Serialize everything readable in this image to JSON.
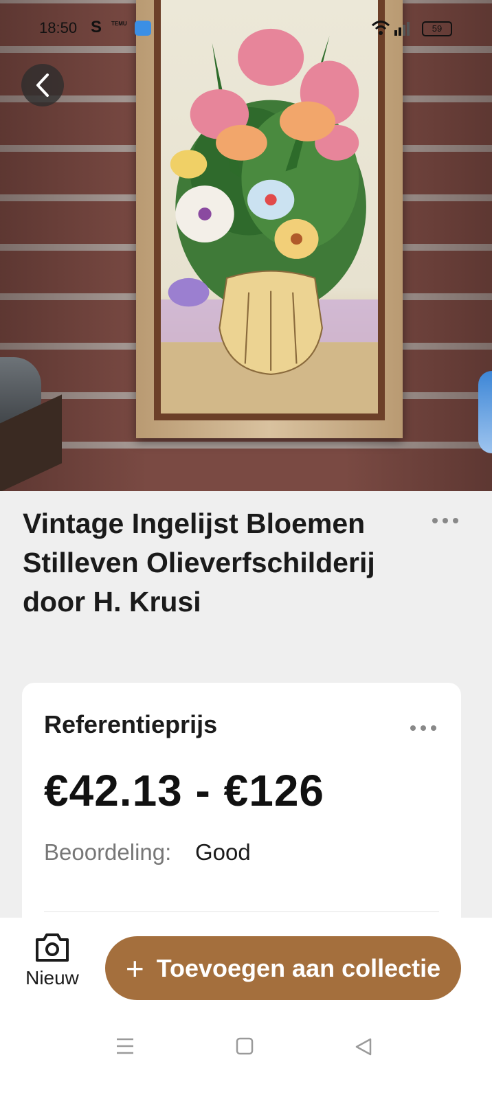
{
  "status_bar": {
    "time": "18:50",
    "s_icon": "S",
    "temu_icon": "TEMU",
    "battery": "59"
  },
  "icons": {
    "back": "chevron-left-icon",
    "more": "more-horizontal-icon",
    "camera": "camera-icon",
    "nav_menu": "menu-icon",
    "nav_home": "square-icon",
    "nav_back": "triangle-back-icon"
  },
  "item": {
    "title": "Vintage Ingelijst Bloemen Stilleven Olieverfschilderij door H. Krusi"
  },
  "price_card": {
    "label": "Referentieprijs",
    "price": "€42.13 - €126",
    "rating_label": "Beoordeling:",
    "rating_value": "Good"
  },
  "bottom_bar": {
    "new_label": "Nieuw",
    "add_plus": "+",
    "add_label": "Toevoegen aan collectie"
  },
  "colors": {
    "accent": "#a46f3d",
    "background": "#efefef",
    "card": "#ffffff"
  }
}
